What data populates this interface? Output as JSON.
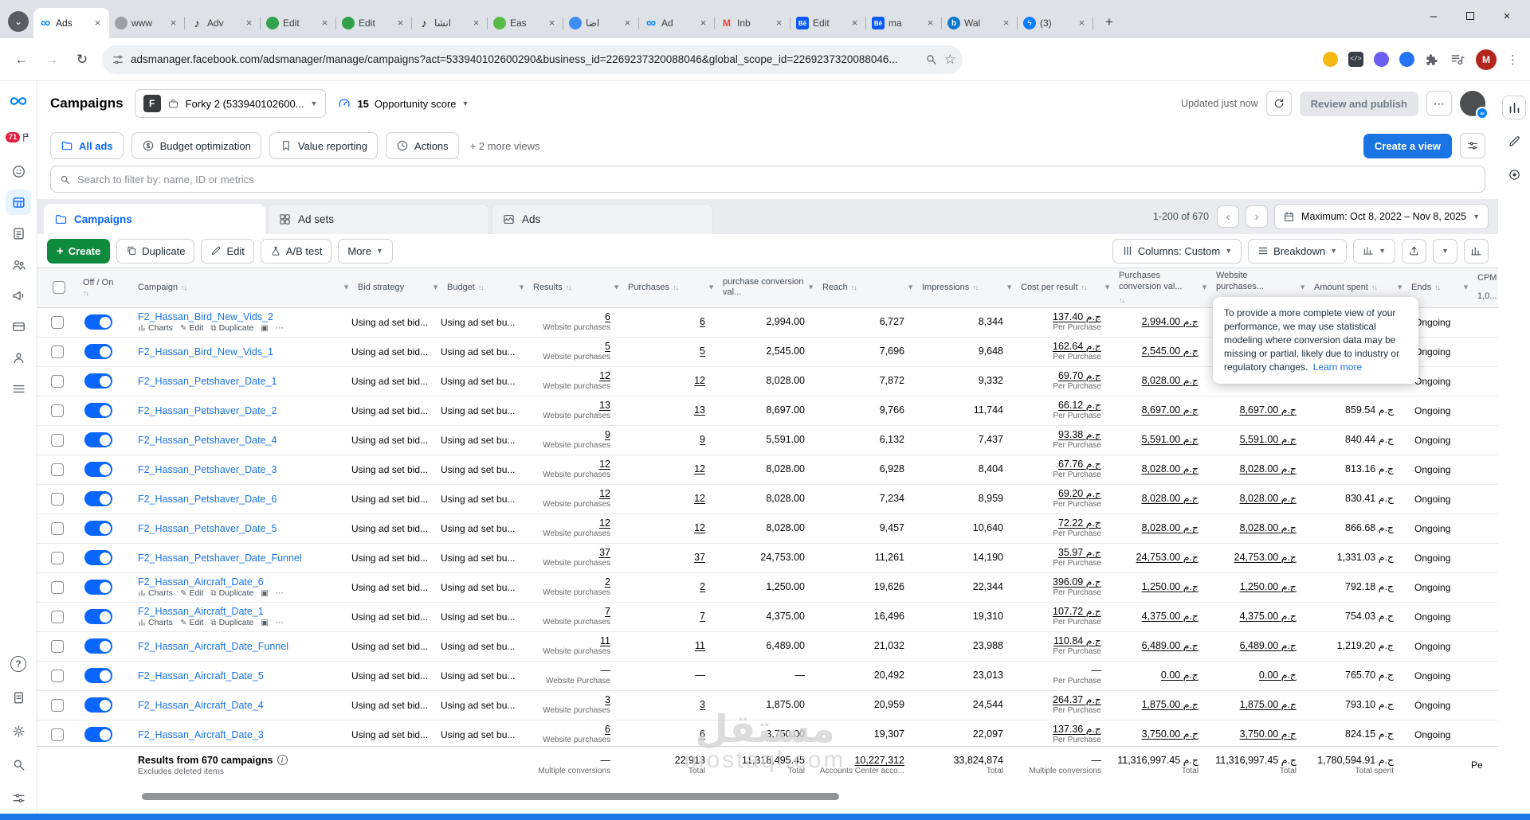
{
  "browser": {
    "tabs": [
      {
        "label": "Ads",
        "icon": "meta",
        "active": true
      },
      {
        "label": "www",
        "icon": "globe"
      },
      {
        "label": "Adv",
        "icon": "tiktok"
      },
      {
        "label": "Edit",
        "icon": "green"
      },
      {
        "label": "Edit",
        "icon": "green"
      },
      {
        "label": "انشا",
        "icon": "tiktok"
      },
      {
        "label": "Eas",
        "icon": "sprout"
      },
      {
        "label": "اضا",
        "icon": "blue"
      },
      {
        "label": "Ad",
        "icon": "meta"
      },
      {
        "label": "Inb",
        "icon": "gmail"
      },
      {
        "label": "Edit",
        "icon": "behance"
      },
      {
        "label": "ma",
        "icon": "behance"
      },
      {
        "label": "Wal",
        "icon": "walblue"
      },
      {
        "label": "(3)",
        "icon": "messenger"
      }
    ],
    "url": "adsmanager.facebook.com/adsmanager/manage/campaigns?act=533940102600290&business_id=2269237320088046&global_scope_id=2269237320088046...",
    "profile_initial": "M"
  },
  "sidebar": {
    "notification_count": "71",
    "items": [
      {
        "name": "account-overview",
        "icon": "smile"
      },
      {
        "name": "campaigns",
        "icon": "grid",
        "active": true
      },
      {
        "name": "ads-reporting",
        "icon": "clipboard"
      },
      {
        "name": "audiences",
        "icon": "people"
      },
      {
        "name": "advertise",
        "icon": "mega"
      },
      {
        "name": "billing",
        "icon": "card"
      },
      {
        "name": "account-settings",
        "icon": "person"
      },
      {
        "name": "all-tools",
        "icon": "menu"
      }
    ],
    "bottom": [
      {
        "name": "help",
        "icon": "help"
      },
      {
        "name": "reports",
        "icon": "doc"
      },
      {
        "name": "settings",
        "icon": "gear"
      },
      {
        "name": "search",
        "icon": "search"
      },
      {
        "name": "preferences",
        "icon": "sliders"
      }
    ]
  },
  "header": {
    "title": "Campaigns",
    "account_initial": "F",
    "account": "Forky 2 (533940102600...",
    "opportunity_score": "15",
    "opportunity_label": "Opportunity score",
    "updated": "Updated just now",
    "review_button": "Review and publish"
  },
  "views": {
    "tabs": [
      {
        "label": "All ads",
        "icon": "folder",
        "active": true
      },
      {
        "label": "Budget optimization",
        "icon": "dollar"
      },
      {
        "label": "Value reporting",
        "icon": "bookmark"
      },
      {
        "label": "Actions",
        "icon": "clock"
      }
    ],
    "more": "+ 2 more views",
    "create_view": "Create a view"
  },
  "search": {
    "placeholder": "Search to filter by: name, ID or metrics"
  },
  "levels": {
    "tabs": [
      {
        "label": "Campaigns",
        "icon": "folder",
        "active": true
      },
      {
        "label": "Ad sets",
        "icon": "adsets"
      },
      {
        "label": "Ads",
        "icon": "adsicon"
      }
    ],
    "pagination": "1-200 of 670",
    "date_range": "Maximum: Oct 8, 2022 – Nov 8, 2025"
  },
  "toolbar": {
    "create": "Create",
    "duplicate": "Duplicate",
    "edit": "Edit",
    "ab_test": "A/B test",
    "more": "More",
    "columns": "Columns: Custom",
    "breakdown": "Breakdown"
  },
  "table": {
    "bid_strategy_text": "Using ad set bid...",
    "budget_text": "Using ad set bu...",
    "row_actions": {
      "charts": "Charts",
      "edit": "Edit",
      "duplicate": "Duplicate"
    },
    "columns": [
      {
        "key": "check",
        "label": ""
      },
      {
        "key": "toggle",
        "label": "Off / On",
        "sort": true
      },
      {
        "key": "name",
        "label": "Campaign",
        "sort": true,
        "menu": true
      },
      {
        "key": "bid",
        "label": "Bid strategy",
        "menu": true
      },
      {
        "key": "budget",
        "label": "Budget",
        "sort": true,
        "menu": true
      },
      {
        "key": "results",
        "label": "Results",
        "sort": true,
        "menu": true
      },
      {
        "key": "purchases",
        "label": "Purchases",
        "sort": true,
        "menu": true
      },
      {
        "key": "conv_val",
        "label": "purchase conversion val...",
        "menu": true
      },
      {
        "key": "reach",
        "label": "Reach",
        "sort": true,
        "menu": true
      },
      {
        "key": "impressions",
        "label": "Impressions",
        "sort": true,
        "menu": true
      },
      {
        "key": "cpr",
        "label": "Cost per result",
        "sort": true,
        "menu": true
      },
      {
        "key": "purch_conv",
        "label": "Purchases conversion val...",
        "sort": true,
        "menu": true
      },
      {
        "key": "web_purch",
        "label": "Website purchases...",
        "sort": true,
        "menu": true
      },
      {
        "key": "amount",
        "label": "Amount spent",
        "sort": true,
        "menu": true
      },
      {
        "key": "ends",
        "label": "Ends",
        "sort": true,
        "menu": true
      },
      {
        "key": "cpi",
        "label": "CPM",
        "sub": "1,0..."
      }
    ],
    "rows": [
      {
        "name": "F2_Hassan_Bird_New_Vids_2",
        "actions": true,
        "results": "6",
        "results_sub": "Website purchases",
        "purchases": "6",
        "conv_val": "2,994.00",
        "reach": "6,727",
        "impressions": "8,344",
        "cpr": "137.40 ج.م",
        "cpr_sub": "Per Purchase",
        "purch_conv": "2,994.00 ج.م",
        "web_purch": "",
        "amount": "",
        "ends": "Ongoing"
      },
      {
        "name": "F2_Hassan_Bird_New_Vids_1",
        "results": "5",
        "results_sub": "Website purchases",
        "purchases": "5",
        "conv_val": "2,545.00",
        "reach": "7,696",
        "impressions": "9,648",
        "cpr": "162.64 ج.م",
        "cpr_sub": "Per Purchase",
        "purch_conv": "2,545.00 ج.م",
        "web_purch": "",
        "amount": "",
        "ends": "Ongoing"
      },
      {
        "name": "F2_Hassan_Petshaver_Date_1",
        "results": "12",
        "results_sub": "Website purchases",
        "purchases": "12",
        "conv_val": "8,028.00",
        "reach": "7,872",
        "impressions": "9,332",
        "cpr": "69.70 ج.م",
        "cpr_sub": "Per Purchase",
        "purch_conv": "8,028.00 ج.م",
        "web_purch": "",
        "amount": "",
        "ends": "Ongoing"
      },
      {
        "name": "F2_Hassan_Petshaver_Date_2",
        "results": "13",
        "results_sub": "Website purchases",
        "purchases": "13",
        "conv_val": "8,697.00",
        "reach": "9,766",
        "impressions": "11,744",
        "cpr": "66.12 ج.م",
        "cpr_sub": "Per Purchase",
        "purch_conv": "8,697.00 ج.م",
        "web_purch": "8,697.00 ج.م",
        "amount": "859.54 ج.م",
        "ends": "Ongoing"
      },
      {
        "name": "F2_Hassan_Petshaver_Date_4",
        "results": "9",
        "results_sub": "Website purchases",
        "purchases": "9",
        "conv_val": "5,591.00",
        "reach": "6,132",
        "impressions": "7,437",
        "cpr": "93.38 ج.م",
        "cpr_sub": "Per Purchase",
        "purch_conv": "5,591.00 ج.م",
        "web_purch": "5,591.00 ج.م",
        "amount": "840.44 ج.م",
        "ends": "Ongoing"
      },
      {
        "name": "F2_Hassan_Petshaver_Date_3",
        "results": "12",
        "results_sub": "Website purchases",
        "purchases": "12",
        "conv_val": "8,028.00",
        "reach": "6,928",
        "impressions": "8,404",
        "cpr": "67.76 ج.م",
        "cpr_sub": "Per Purchase",
        "purch_conv": "8,028.00 ج.م",
        "web_purch": "8,028.00 ج.م",
        "amount": "813.16 ج.م",
        "ends": "Ongoing"
      },
      {
        "name": "F2_Hassan_Petshaver_Date_6",
        "results": "12",
        "results_sub": "Website purchases",
        "purchases": "12",
        "conv_val": "8,028.00",
        "reach": "7,234",
        "impressions": "8,959",
        "cpr": "69.20 ج.م",
        "cpr_sub": "Per Purchase",
        "purch_conv": "8,028.00 ج.م",
        "web_purch": "8,028.00 ج.م",
        "amount": "830.41 ج.م",
        "ends": "Ongoing"
      },
      {
        "name": "F2_Hassan_Petshaver_Date_5",
        "results": "12",
        "results_sub": "Website purchases",
        "purchases": "12",
        "conv_val": "8,028.00",
        "reach": "9,457",
        "impressions": "10,640",
        "cpr": "72.22 ج.م",
        "cpr_sub": "Per Purchase",
        "purch_conv": "8,028.00 ج.م",
        "web_purch": "8,028.00 ج.م",
        "amount": "866.68 ج.م",
        "ends": "Ongoing"
      },
      {
        "name": "F2_Hassan_Petshaver_Date_Funnel",
        "results": "37",
        "results_sub": "Website purchases",
        "purchases": "37",
        "conv_val": "24,753.00",
        "reach": "11,261",
        "impressions": "14,190",
        "cpr": "35.97 ج.م",
        "cpr_sub": "Per Purchase",
        "purch_conv": "24,753.00 ج.م",
        "web_purch": "24,753.00 ج.م",
        "amount": "1,331.03 ج.م",
        "ends": "Ongoing"
      },
      {
        "name": "F2_Hassan_Aircraft_Date_6",
        "actions": true,
        "results": "2",
        "results_sub": "Website purchases",
        "purchases": "2",
        "conv_val": "1,250.00",
        "reach": "19,626",
        "impressions": "22,344",
        "cpr": "396.09 ج.م",
        "cpr_sub": "Per Purchase",
        "purch_conv": "1,250.00 ج.م",
        "web_purch": "1,250.00 ج.م",
        "amount": "792.18 ج.م",
        "ends": "Ongoing"
      },
      {
        "name": "F2_Hassan_Aircraft_Date_1",
        "actions": true,
        "results": "7",
        "results_sub": "Website purchases",
        "purchases": "7",
        "conv_val": "4,375.00",
        "reach": "16,496",
        "impressions": "19,310",
        "cpr": "107.72 ج.م",
        "cpr_sub": "Per Purchase",
        "purch_conv": "4,375.00 ج.م",
        "web_purch": "4,375.00 ج.م",
        "amount": "754.03 ج.م",
        "ends": "Ongoing"
      },
      {
        "name": "F2_Hassan_Aircraft_Date_Funnel",
        "results": "11",
        "results_sub": "Website purchases",
        "purchases": "11",
        "conv_val": "6,489.00",
        "reach": "21,032",
        "impressions": "23,988",
        "cpr": "110.84 ج.م",
        "cpr_sub": "Per Purchase",
        "purch_conv": "6,489.00 ج.م",
        "web_purch": "6,489.00 ج.م",
        "amount": "1,219.20 ج.م",
        "ends": "Ongoing"
      },
      {
        "name": "F2_Hassan_Aircraft_Date_5",
        "results": "—",
        "results_sub": "Website Purchase",
        "purchases": "—",
        "conv_val": "—",
        "reach": "20,492",
        "impressions": "23,013",
        "cpr": "—",
        "cpr_sub": "Per Purchase",
        "purch_conv": "0.00 ج.م",
        "web_purch": "0.00 ج.م",
        "amount": "765.70 ج.م",
        "ends": "Ongoing"
      },
      {
        "name": "F2_Hassan_Aircraft_Date_4",
        "results": "3",
        "results_sub": "Website purchases",
        "purchases": "3",
        "conv_val": "1,875.00",
        "reach": "20,959",
        "impressions": "24,544",
        "cpr": "264.37 ج.م",
        "cpr_sub": "Per Purchase",
        "purch_conv": "1,875.00 ج.م",
        "web_purch": "1,875.00 ج.م",
        "amount": "793.10 ج.م",
        "ends": "Ongoing"
      },
      {
        "name": "F2_Hassan_Aircraft_Date_3",
        "results": "6",
        "results_sub": "Website purchases",
        "purchases": "6",
        "conv_val": "3,750.00",
        "reach": "19,307",
        "impressions": "22,097",
        "cpr": "137.36 ج.م",
        "cpr_sub": "Per Purchase",
        "purch_conv": "3,750.00 ج.م",
        "web_purch": "3,750.00 ج.م",
        "amount": "824.15 ج.م",
        "ends": "Ongoing"
      }
    ],
    "footer": {
      "title": "Results from 670 campaigns",
      "subtitle": "Excludes deleted items",
      "results": "—",
      "results_sub": "Multiple conversions",
      "purchases": "22,913",
      "purchases_sub": "Total",
      "conv_val": "11,318,495.45",
      "conv_val_sub": "Total",
      "reach": "10,227,312",
      "reach_sub": "Accounts Center acco...",
      "impressions": "33,824,874",
      "impressions_sub": "Total",
      "cpr": "—",
      "cpr_sub": "Multiple conversions",
      "purch_conv": "11,316,997.45 ج.م",
      "purch_conv_sub": "Total",
      "web_purch": "11,316,997.45 ج.م",
      "web_purch_sub": "Total",
      "amount": "1,780,594.91 ج.م",
      "amount_sub": "Total spent",
      "ends": "",
      "cpi": "Pe"
    }
  },
  "tooltip": {
    "text": "To provide a more complete view of your performance, we may use statistical modeling where conversion data may be missing or partial, likely due to industry or regulatory changes.",
    "link": "Learn more"
  },
  "watermark": {
    "arabic": "مستقل",
    "latin": "mostaql.com"
  }
}
